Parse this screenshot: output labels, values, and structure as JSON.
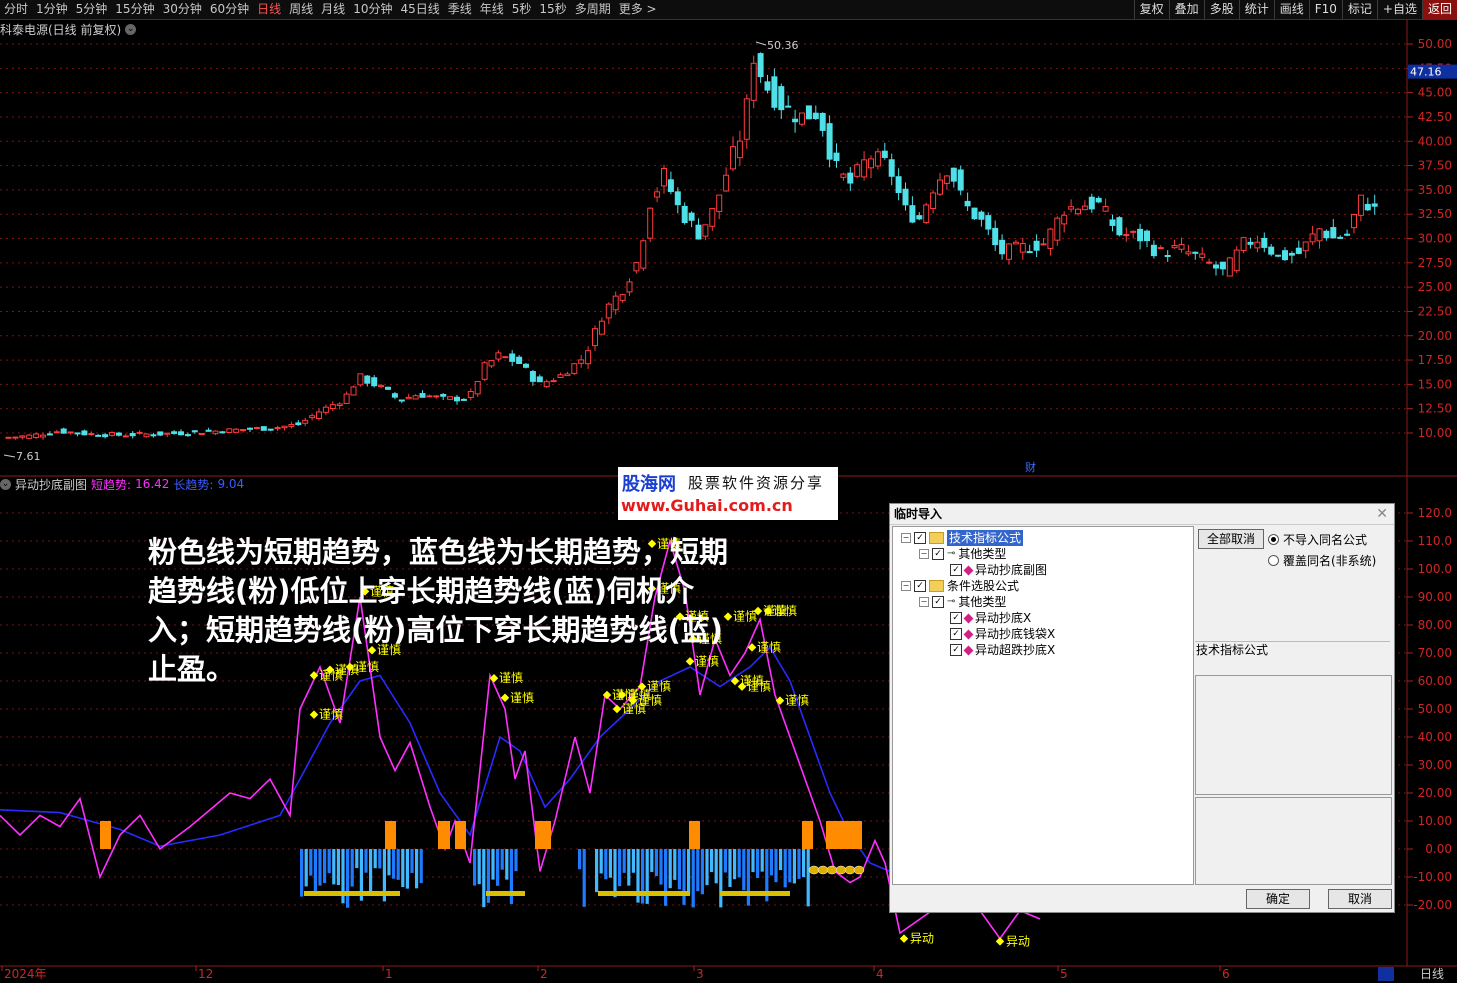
{
  "toolbar": {
    "periods": [
      "分时",
      "1分钟",
      "5分钟",
      "15分钟",
      "30分钟",
      "60分钟",
      "日线",
      "周线",
      "月线",
      "10分钟",
      "45日线",
      "季线",
      "年线",
      "5秒",
      "15秒",
      "多周期",
      "更多 >"
    ],
    "active_period": "日线",
    "right_tools": [
      "复权",
      "叠加",
      "多股",
      "统计",
      "画线",
      "F10",
      "标记",
      "+自选",
      "返回"
    ]
  },
  "stock": {
    "title": "科泰电源(日线 前复权)"
  },
  "price_axis": {
    "labels": [
      "50.00",
      "47.50",
      "45.00",
      "42.50",
      "40.00",
      "37.50",
      "35.00",
      "32.50",
      "30.00",
      "27.50",
      "25.00",
      "22.50",
      "20.00",
      "17.50",
      "15.00",
      "12.50",
      "10.00"
    ],
    "current_price": "47.16",
    "high_mark": "50.36",
    "low_mark": "7.61"
  },
  "indicator": {
    "name": "异动抄底副图",
    "short_label": "短趋势:",
    "short_value": "16.42",
    "long_label": "长趋势:",
    "long_value": "9.04",
    "axis_labels": [
      "120.0",
      "110.0",
      "100.0",
      "90.00",
      "80.00",
      "70.00",
      "60.00",
      "50.00",
      "40.00",
      "30.00",
      "20.00",
      "10.00",
      "0.00",
      "-10.00",
      "-20.00"
    ],
    "caution_text": "谨慎",
    "signal_text": "异动",
    "cai": "财"
  },
  "date_axis": [
    "2024年",
    "12",
    "1",
    "2",
    "3",
    "4",
    "5",
    "6"
  ],
  "period_footer": "日线",
  "overlay_note": "粉色线为短期趋势，蓝色线为长期趋势，短期趋势线(粉)低位上穿长期趋势线(蓝)伺机介入；短期趋势线(粉)高位下穿长期趋势线(蓝)止盈。",
  "logo": {
    "name": "股海网",
    "slogan": "股票软件资源分享",
    "url": "www.Guhai.com.cn"
  },
  "dialog": {
    "title": "临时导入",
    "tree": [
      {
        "label": "技术指标公式",
        "level": 0,
        "type": "folder",
        "selected": true
      },
      {
        "label": "其他类型",
        "level": 1,
        "type": "key"
      },
      {
        "label": "异动抄底副图",
        "level": 2,
        "type": "formula"
      },
      {
        "label": "条件选股公式",
        "level": 0,
        "type": "folder"
      },
      {
        "label": "其他类型",
        "level": 1,
        "type": "key"
      },
      {
        "label": "异动抄底X",
        "level": 2,
        "type": "formula"
      },
      {
        "label": "异动抄底钱袋X",
        "level": 2,
        "type": "formula"
      },
      {
        "label": "异动超跌抄底X",
        "level": 2,
        "type": "formula"
      }
    ],
    "cancel_all": "全部取消",
    "radio_no_import": "不导入同名公式",
    "radio_overwrite": "覆盖同名(非系统)",
    "info_label": "技术指标公式",
    "ok": "确定",
    "cancel": "取消"
  },
  "colors": {
    "up": "#ff3b3b",
    "down": "#4fe0e8",
    "short_line": "#ff30ff",
    "long_line": "#2a2aff",
    "caution": "#ffff00",
    "orange_bar": "#ff8c00",
    "blue_bar": "#1e7bff",
    "grid": "#7a1515"
  }
}
